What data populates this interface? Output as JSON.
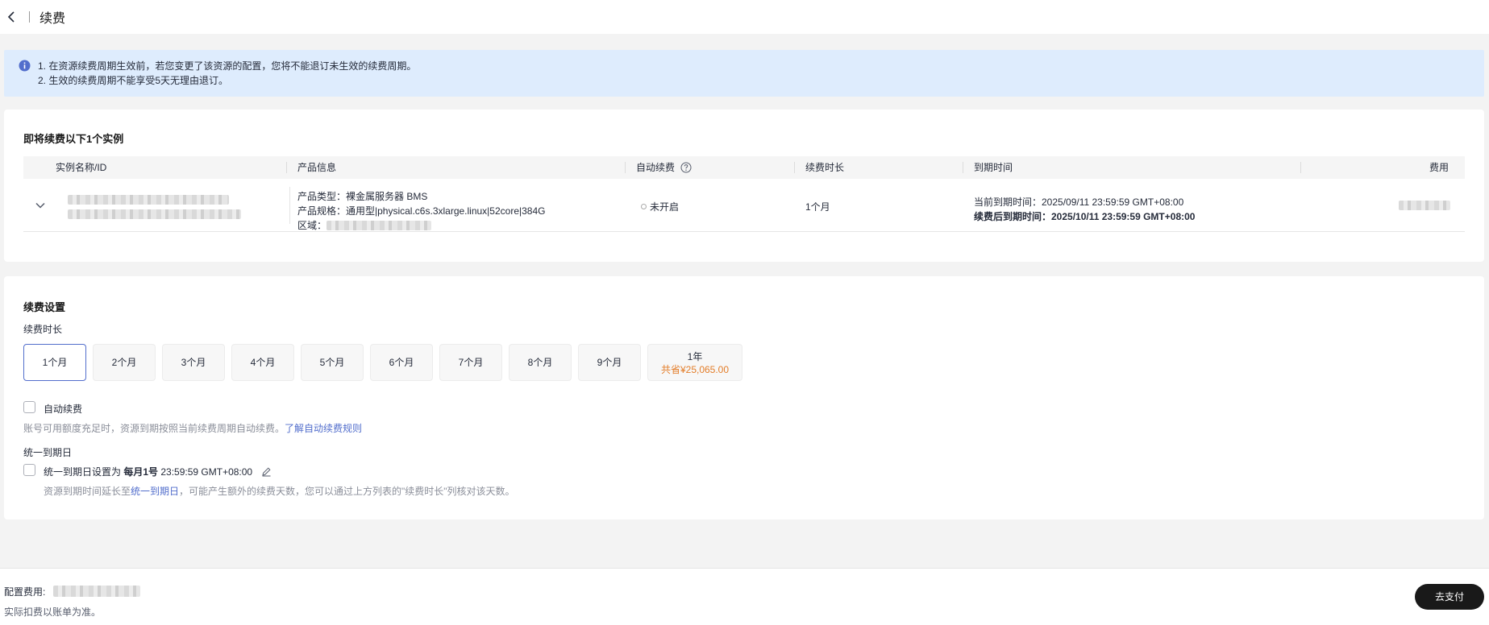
{
  "header": {
    "title": "续费"
  },
  "notice": {
    "line1": "1. 在资源续费周期生效前，若您变更了该资源的配置，您将不能退订未生效的续费周期。",
    "line2": "2. 生效的续费周期不能享受5天无理由退订。"
  },
  "instances": {
    "title": "即将续费以下1个实例",
    "columns": {
      "name": "实例名称/ID",
      "product": "产品信息",
      "auto_renew": "自动续费",
      "duration": "续费时长",
      "expiry": "到期时间",
      "fee": "费用"
    },
    "row": {
      "product_type": "产品类型：裸金属服务器 BMS",
      "product_spec": "产品规格：通用型|physical.c6s.3xlarge.linux|52core|384G",
      "region_label": "区域：",
      "auto_renew_status": "未开启",
      "duration": "1个月",
      "current_expiry": "当前到期时间：2025/09/11 23:59:59 GMT+08:00",
      "renewed_expiry": "续费后到期时间：2025/10/11 23:59:59 GMT+08:00"
    }
  },
  "settings": {
    "title": "续费设置",
    "duration_label": "续费时长",
    "options": [
      "1个月",
      "2个月",
      "3个月",
      "4个月",
      "5个月",
      "6个月",
      "7个月",
      "8个月",
      "9个月"
    ],
    "selected": "1个月",
    "year_option": "1年",
    "year_saving": "共省¥25,065.00",
    "auto_renew_label": "自动续费",
    "auto_renew_desc": "账号可用额度充足时，资源到期按照当前续费周期自动续费。",
    "auto_renew_link": "了解自动续费规则",
    "unify_title": "统一到期日",
    "unify_prefix": "统一到期日设置为 ",
    "unify_day": "每月1号",
    "unify_time": " 23:59:59 GMT+08:00",
    "unify_desc_prefix": "资源到期时间延长至",
    "unify_desc_link": "统一到期日",
    "unify_desc_suffix": "，可能产生额外的续费天数，您可以通过上方列表的\"续费时长\"列核对该天数。"
  },
  "footer": {
    "fee_label": "配置费用:",
    "note": "实际扣费以账单为准。",
    "pay_button": "去支付"
  }
}
